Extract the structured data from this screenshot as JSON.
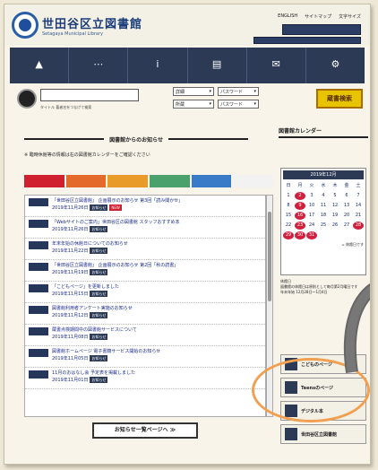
{
  "site": {
    "name": "世田谷区立図書館",
    "sub": "Setagaya Municipal Library"
  },
  "toplinks": [
    "ENGLISH",
    "サイトマップ",
    "文字サイズ"
  ],
  "nav": [
    {
      "label": "",
      "icon": "person-icon"
    },
    {
      "label": "",
      "icon": "search-icon"
    },
    {
      "label": "",
      "icon": "info-icon"
    },
    {
      "label": "",
      "icon": "book-icon"
    },
    {
      "label": "",
      "icon": "mail-icon"
    },
    {
      "label": "",
      "icon": "gear-icon"
    }
  ],
  "search": {
    "avatar_label": "",
    "hint": "タイトル 著者名をつなげて検索",
    "sel1": "詳細",
    "sel2": "パスワード",
    "sel3": "所蔵",
    "sel4": "パスワード",
    "button": "蔵書検索"
  },
  "recent": {
    "title": "図書館からのお知らせ"
  },
  "notice": "※ 臨時休館等の情報は右の図書館カレンダーをご確認ください",
  "tabs": [
    {
      "label": "",
      "color": "#d02030"
    },
    {
      "label": "",
      "color": "#e36a2a"
    },
    {
      "label": "",
      "color": "#e99b2a"
    },
    {
      "label": "",
      "color": "#4aa16b"
    },
    {
      "label": "",
      "color": "#3a7bc8"
    },
    {
      "label": "",
      "color": "#f2f2f2"
    }
  ],
  "items": [
    {
      "text": "「世田谷区立図書館」 企画展示のお知らせ 第3回「読み聞かせ」",
      "date": "2019年11月26日",
      "badge": "お知らせ",
      "new": true
    },
    {
      "text": "「Webサイトのご案内」世田谷区の図書館 スタッフおすすめ本",
      "date": "2019年11月26日",
      "badge": "お知らせ",
      "new": false
    },
    {
      "text": "年末年始の休館日についてのお知らせ",
      "date": "2019年11月22日",
      "badge": "お知らせ",
      "new": false
    },
    {
      "text": "「世田谷区立図書館」 企画展示のお知らせ 第2回「秋の読書」",
      "date": "2019年11月19日",
      "badge": "お知らせ",
      "new": false
    },
    {
      "text": "「こどもページ」を更新しました",
      "date": "2019年11月15日",
      "badge": "お知らせ",
      "new": false
    },
    {
      "text": "図書館利用者アンケート実施のお知らせ",
      "date": "2019年11月12日",
      "badge": "お知らせ",
      "new": false
    },
    {
      "text": "蔵書点検期間中の図書館サービスについて",
      "date": "2019年11月08日",
      "badge": "お知らせ",
      "new": false
    },
    {
      "text": "図書館ホームページ 電子書籍サービス開始のお知らせ",
      "date": "2019年11月05日",
      "badge": "お知らせ",
      "new": false
    },
    {
      "text": "11月のおはなし会 予定表を掲載しました",
      "date": "2019年11月01日",
      "badge": "お知らせ",
      "new": false
    }
  ],
  "more_label": "お知らせ一覧ページへ ≫",
  "calendar": {
    "title": "図書館カレンダー",
    "month": "2019年12月",
    "days": [
      "日",
      "月",
      "火",
      "水",
      "木",
      "金",
      "土",
      "1",
      "2",
      "3",
      "4",
      "5",
      "6",
      "7",
      "8",
      "9",
      "10",
      "11",
      "12",
      "13",
      "14",
      "15",
      "16",
      "17",
      "18",
      "19",
      "20",
      "21",
      "22",
      "23",
      "24",
      "25",
      "26",
      "27",
      "28",
      "29",
      "30",
      "31",
      "",
      "",
      "",
      ""
    ],
    "holidays": [
      "2",
      "9",
      "16",
      "23",
      "28",
      "29",
      "30",
      "31"
    ],
    "legend": "= 休館日です"
  },
  "info": "休館日\n図書館の休館日は原則として毎月第2月曜日です\n年末年始 12月28日～1月4日",
  "side_buttons": [
    {
      "label": "こどものページ"
    },
    {
      "label": "Teensのページ"
    },
    {
      "label": "デジタル本"
    },
    {
      "label": "世田谷区立図書館"
    }
  ]
}
